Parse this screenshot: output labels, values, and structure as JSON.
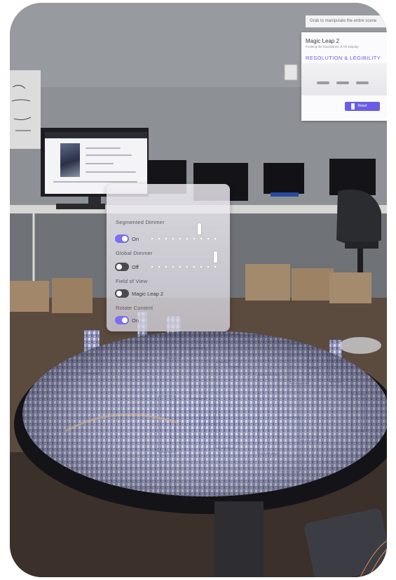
{
  "banner": {
    "text": "Grab to manipulate the entire scene"
  },
  "magic_leap_panel": {
    "title": "Magic Leap 2",
    "subtitle": "Pushing the boundaries of AR Display",
    "heading": "RESOLUTION & LEGIBILITY",
    "button_label": "Reset"
  },
  "controls_panel": {
    "segmented_dimmer": {
      "label": "Segmented Dimmer",
      "state_label": "On",
      "enabled": true,
      "slider_level": 0.72
    },
    "global_dimmer": {
      "label": "Global Dimmer",
      "state_label": "Off",
      "enabled": false,
      "slider_level": 0.95
    },
    "field_of_view": {
      "label": "Field of View",
      "state_label": "Magic Leap 2",
      "enabled": false
    },
    "rotate_content": {
      "label": "Rotate Content",
      "state_label": "On",
      "enabled": true
    }
  },
  "colors": {
    "accent": "#7b6ef2",
    "toggle_off": "#4a4a52",
    "panel": "#ebe9f0"
  }
}
